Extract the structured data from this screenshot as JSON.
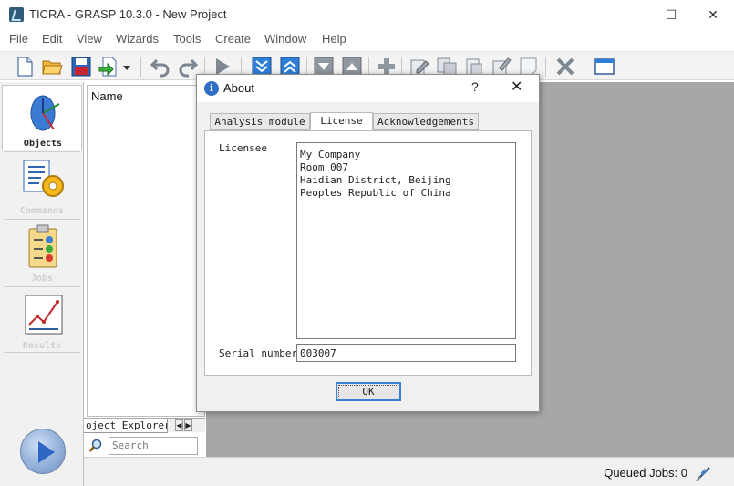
{
  "window": {
    "title": "TICRA - GRASP 10.3.0 - New Project",
    "minimize": "—",
    "maximize": "☐",
    "close": "✕"
  },
  "menu": [
    "File",
    "Edit",
    "View",
    "Wizards",
    "Tools",
    "Create",
    "Window",
    "Help"
  ],
  "toolbar": {
    "icons": [
      "new-file-icon",
      "open-folder-icon",
      "save-icon",
      "import-icon",
      "undo-icon",
      "redo-icon",
      "run-icon",
      "move-down-icon",
      "move-up-icon",
      "collapse-icon",
      "expand-icon",
      "add-icon",
      "edit-icon",
      "copy-objects-icon",
      "paste-icon",
      "wizard-edit-icon",
      "blank-icon",
      "delete-icon",
      "window-icon"
    ]
  },
  "sidebar": {
    "items": [
      {
        "label": "Objects",
        "icon": "objects-icon",
        "active": true
      },
      {
        "label": "Commands",
        "icon": "commands-icon",
        "active": false
      },
      {
        "label": "Jobs",
        "icon": "jobs-icon",
        "active": false
      },
      {
        "label": "Results",
        "icon": "results-icon",
        "active": false
      }
    ]
  },
  "explorer": {
    "column_header": "Name",
    "tab_label": "oject Explorer",
    "search_placeholder": "Search"
  },
  "status": {
    "queued_jobs": "Queued Jobs: 0"
  },
  "dialog": {
    "title": "About",
    "help": "?",
    "close": "✕",
    "tabs": [
      "Analysis module",
      "License",
      "Acknowledgements"
    ],
    "active_tab": "License",
    "licensee_label": "Licensee",
    "licensee_lines": [
      "My Company",
      "Room 007",
      "Haidian District, Beijing",
      "Peoples Republic of China"
    ],
    "serial_label": "Serial number",
    "serial_value": "003007",
    "ok_label": "OK"
  },
  "colors": {
    "workspace": "#a7a7a7",
    "accent": "#3b7fd4",
    "toolbar_blue": "#2f7ed8"
  }
}
